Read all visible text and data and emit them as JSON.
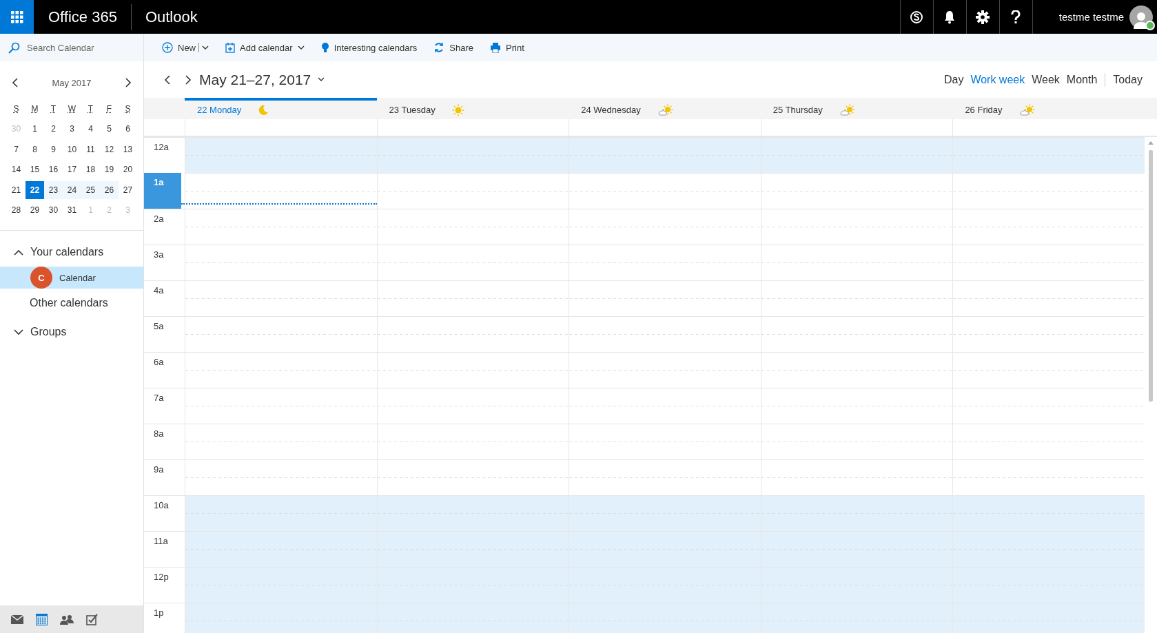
{
  "topbar": {
    "suite": "Office 365",
    "app": "Outlook",
    "user": "testme testme"
  },
  "search": {
    "placeholder": "Search Calendar"
  },
  "toolbar": [
    {
      "label": "New",
      "kind": "split"
    },
    {
      "label": "Add calendar",
      "kind": "dropdown"
    },
    {
      "label": "Interesting calendars",
      "kind": "plain"
    },
    {
      "label": "Share",
      "kind": "plain"
    },
    {
      "label": "Print",
      "kind": "plain"
    }
  ],
  "mini_calendar": {
    "title": "May 2017",
    "weekdays": [
      "S",
      "M",
      "T",
      "W",
      "T",
      "F",
      "S"
    ],
    "weeks": [
      [
        {
          "d": "30",
          "muted": true,
          "selected": false,
          "in_week": false
        },
        {
          "d": "1",
          "muted": false,
          "selected": false,
          "in_week": false
        },
        {
          "d": "2",
          "muted": false,
          "selected": false,
          "in_week": false
        },
        {
          "d": "3",
          "muted": false,
          "selected": false,
          "in_week": false
        },
        {
          "d": "4",
          "muted": false,
          "selected": false,
          "in_week": false
        },
        {
          "d": "5",
          "muted": false,
          "selected": false,
          "in_week": false
        },
        {
          "d": "6",
          "muted": false,
          "selected": false,
          "in_week": false
        }
      ],
      [
        {
          "d": "7",
          "muted": false,
          "selected": false,
          "in_week": false
        },
        {
          "d": "8",
          "muted": false,
          "selected": false,
          "in_week": false
        },
        {
          "d": "9",
          "muted": false,
          "selected": false,
          "in_week": false
        },
        {
          "d": "10",
          "muted": false,
          "selected": false,
          "in_week": false
        },
        {
          "d": "11",
          "muted": false,
          "selected": false,
          "in_week": false
        },
        {
          "d": "12",
          "muted": false,
          "selected": false,
          "in_week": false
        },
        {
          "d": "13",
          "muted": false,
          "selected": false,
          "in_week": false
        }
      ],
      [
        {
          "d": "14",
          "muted": false,
          "selected": false,
          "in_week": false
        },
        {
          "d": "15",
          "muted": false,
          "selected": false,
          "in_week": false
        },
        {
          "d": "16",
          "muted": false,
          "selected": false,
          "in_week": false
        },
        {
          "d": "17",
          "muted": false,
          "selected": false,
          "in_week": false
        },
        {
          "d": "18",
          "muted": false,
          "selected": false,
          "in_week": false
        },
        {
          "d": "19",
          "muted": false,
          "selected": false,
          "in_week": false
        },
        {
          "d": "20",
          "muted": false,
          "selected": false,
          "in_week": false
        }
      ],
      [
        {
          "d": "21",
          "muted": false,
          "selected": false,
          "in_week": false
        },
        {
          "d": "22",
          "muted": false,
          "selected": true,
          "in_week": true
        },
        {
          "d": "23",
          "muted": false,
          "selected": false,
          "in_week": true
        },
        {
          "d": "24",
          "muted": false,
          "selected": false,
          "in_week": true
        },
        {
          "d": "25",
          "muted": false,
          "selected": false,
          "in_week": true
        },
        {
          "d": "26",
          "muted": false,
          "selected": false,
          "in_week": true
        },
        {
          "d": "27",
          "muted": false,
          "selected": false,
          "in_week": false
        }
      ],
      [
        {
          "d": "28",
          "muted": false,
          "selected": false,
          "in_week": false
        },
        {
          "d": "29",
          "muted": false,
          "selected": false,
          "in_week": false
        },
        {
          "d": "30",
          "muted": false,
          "selected": false,
          "in_week": false
        },
        {
          "d": "31",
          "muted": false,
          "selected": false,
          "in_week": false
        },
        {
          "d": "1",
          "muted": true,
          "selected": false,
          "in_week": false
        },
        {
          "d": "2",
          "muted": true,
          "selected": false,
          "in_week": false
        },
        {
          "d": "3",
          "muted": true,
          "selected": false,
          "in_week": false
        }
      ]
    ]
  },
  "sidebar": {
    "sections": [
      {
        "label": "Your calendars",
        "kind": "group",
        "expanded": true,
        "children": [
          {
            "label": "Calendar",
            "initial": "C",
            "color": "#d9532c",
            "selected": true
          }
        ]
      },
      {
        "label": "Other calendars",
        "kind": "plain"
      },
      {
        "label": "Groups",
        "kind": "group",
        "expanded": false
      }
    ]
  },
  "bottom_nav": [
    {
      "selected": false
    },
    {
      "selected": true
    },
    {
      "selected": false
    },
    {
      "selected": false
    }
  ],
  "range_title": "May 21–27, 2017",
  "views": [
    {
      "label": "Day",
      "selected": false
    },
    {
      "label": "Work week",
      "selected": true
    },
    {
      "label": "Week",
      "selected": false
    },
    {
      "label": "Month",
      "selected": false
    }
  ],
  "today_button": "Today",
  "days": [
    {
      "label": "22 Monday",
      "kind": "moon",
      "selected": true
    },
    {
      "label": "23 Tuesday",
      "kind": "sun",
      "selected": false
    },
    {
      "label": "24 Wednesday",
      "kind": "cloudsun",
      "selected": false
    },
    {
      "label": "25 Thursday",
      "kind": "cloudsun",
      "selected": false
    },
    {
      "label": "26 Friday",
      "kind": "cloudsun",
      "selected": false
    }
  ],
  "hours": [
    {
      "label": "12a",
      "shaded": true,
      "current": false
    },
    {
      "label": "1a",
      "shaded": false,
      "current": true
    },
    {
      "label": "2a",
      "shaded": false,
      "current": false
    },
    {
      "label": "3a",
      "shaded": false,
      "current": false
    },
    {
      "label": "4a",
      "shaded": false,
      "current": false
    },
    {
      "label": "5a",
      "shaded": false,
      "current": false
    },
    {
      "label": "6a",
      "shaded": false,
      "current": false
    },
    {
      "label": "7a",
      "shaded": false,
      "current": false
    },
    {
      "label": "8a",
      "shaded": false,
      "current": false
    },
    {
      "label": "9a",
      "shaded": false,
      "current": false
    },
    {
      "label": "10a",
      "shaded": true,
      "current": false
    },
    {
      "label": "11a",
      "shaded": true,
      "current": false
    },
    {
      "label": "12p",
      "shaded": true,
      "current": false
    },
    {
      "label": "1p",
      "shaded": true,
      "current": false
    }
  ]
}
